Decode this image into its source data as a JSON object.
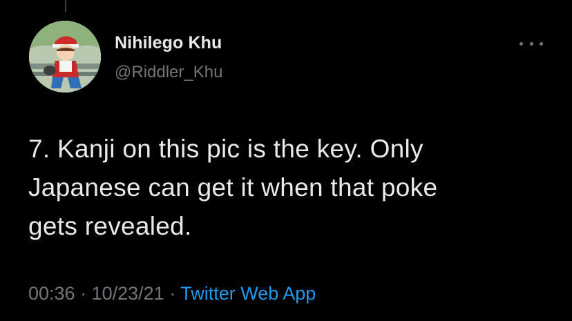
{
  "tweet": {
    "author_name": "Nihilego Khu",
    "author_handle": "@Riddler_Khu",
    "text": "7. Kanji on this pic is the key. Only\nJapanese can get it when that poke\ngets revealed.",
    "time": "00:36",
    "separator": " · ",
    "date": "10/23/21",
    "source": "Twitter Web App"
  },
  "icons": {
    "more": "more-horizontal-icon"
  },
  "colors": {
    "background": "#000000",
    "primary_text": "#e7e9ea",
    "secondary_text": "#71767b",
    "link": "#1d9bf0"
  }
}
